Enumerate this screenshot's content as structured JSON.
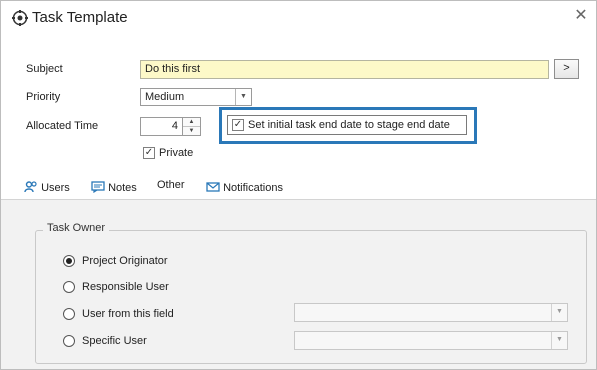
{
  "window": {
    "title": "Task Template",
    "close_glyph": "✕"
  },
  "form": {
    "subject_label": "Subject",
    "subject_value": "Do this first",
    "more_button": ">",
    "priority_label": "Priority",
    "priority_value": "Medium",
    "allocated_label": "Allocated Time",
    "allocated_value": "4",
    "stage_end_label": "Set initial task end date to stage end date",
    "stage_end_checked": true,
    "private_label": "Private",
    "private_checked": true
  },
  "tabs": [
    {
      "label": "Users",
      "icon": "users-icon",
      "active": true
    },
    {
      "label": "Notes",
      "icon": "notes-icon"
    },
    {
      "label": "Other"
    },
    {
      "label": "Notifications",
      "icon": "mail-icon"
    }
  ],
  "task_owner": {
    "title": "Task Owner",
    "options": [
      {
        "label": "Project Originator",
        "selected": true
      },
      {
        "label": "Responsible User",
        "selected": false
      },
      {
        "label": "User from this field",
        "selected": false,
        "combo_value": ""
      },
      {
        "label": "Specific User",
        "selected": false,
        "combo_value": ""
      }
    ]
  },
  "colors": {
    "highlight": "#2a78b8",
    "subject_bg": "#fdf9c8",
    "panel_bg": "#f2f2f2"
  }
}
